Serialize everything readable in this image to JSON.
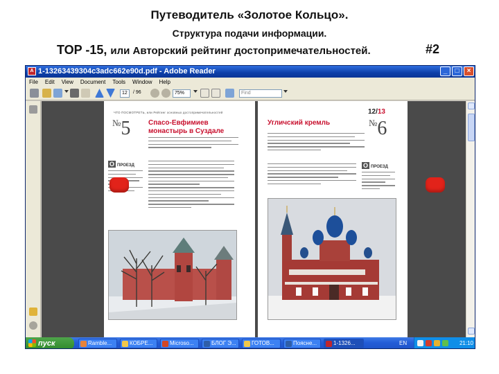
{
  "slide": {
    "title": "Путеводитель «Золотое Кольцо».",
    "subtitle": "Структура подачи информации.",
    "top_prefix": "TOP -15, ",
    "top_rest": "или Авторский рейтинг достопримечательностей.",
    "slide_number": "#2"
  },
  "window": {
    "title": "1-13263439304c3adc662e90d.pdf - Adobe Reader",
    "buttons": {
      "minimize": "_",
      "maximize": "□",
      "close": "×"
    }
  },
  "menu": [
    "File",
    "Edit",
    "View",
    "Document",
    "Tools",
    "Window",
    "Help"
  ],
  "toolbar": {
    "page_current": "12",
    "page_total": "/ 96",
    "zoom": "75%",
    "find_placeholder": "Find"
  },
  "document": {
    "left_page": {
      "running_head": "ЧТО ПОСМОТРЕТЬ, или Рейтинг основных достопримечательностей",
      "number_label": "№",
      "number": "5",
      "title": "Спасо-Евфимиев монастырь в Суздале",
      "sidebar_tag": "ПРОЕЗД"
    },
    "right_page": {
      "page_number_current": "12/",
      "page_number_total": "13",
      "number_label": "№",
      "number": "6",
      "title": "Угличский кремль",
      "sidebar_tag": "ПРОЕЗД"
    }
  },
  "taskbar": {
    "start": "пуск",
    "tasks": [
      "Ramble...",
      "КОБРЕ...",
      "Microso...",
      "БЛОГ Э...",
      "ГОТОВ...",
      "Поясне...",
      "1-1326..."
    ],
    "language": "EN",
    "clock": "21:10"
  },
  "colors": {
    "accent_red": "#c8102e",
    "titlebar_blue": "#0d3fa8",
    "taskbar_blue": "#245ed8",
    "start_green": "#2f8a2c"
  }
}
